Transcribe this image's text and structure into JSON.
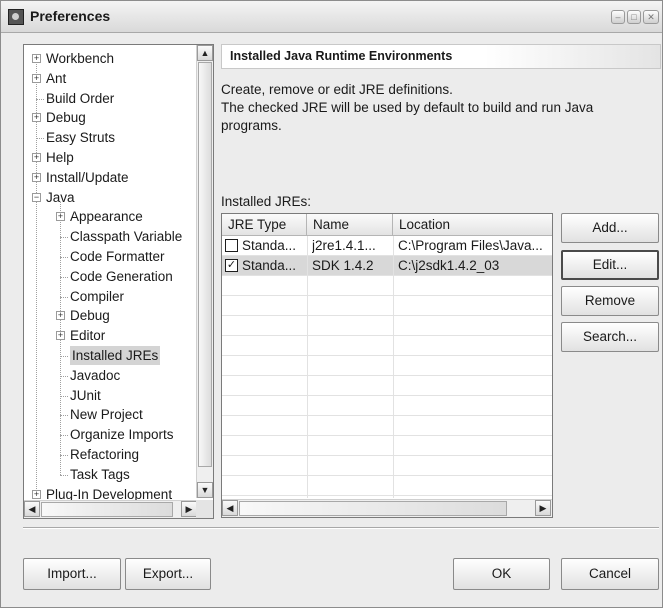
{
  "window": {
    "title": "Preferences"
  },
  "tree": {
    "items": [
      {
        "label": "Workbench",
        "expander": "+",
        "level": 0
      },
      {
        "label": "Ant",
        "expander": "+",
        "level": 0
      },
      {
        "label": "Build Order",
        "expander": "",
        "level": 0
      },
      {
        "label": "Debug",
        "expander": "+",
        "level": 0
      },
      {
        "label": "Easy Struts",
        "expander": "",
        "level": 0
      },
      {
        "label": "Help",
        "expander": "+",
        "level": 0
      },
      {
        "label": "Install/Update",
        "expander": "+",
        "level": 0
      },
      {
        "label": "Java",
        "expander": "-",
        "level": 0
      },
      {
        "label": "Appearance",
        "expander": "+",
        "level": 1
      },
      {
        "label": "Classpath Variable",
        "expander": "",
        "level": 1
      },
      {
        "label": "Code Formatter",
        "expander": "",
        "level": 1
      },
      {
        "label": "Code Generation",
        "expander": "",
        "level": 1
      },
      {
        "label": "Compiler",
        "expander": "",
        "level": 1
      },
      {
        "label": "Debug",
        "expander": "+",
        "level": 1
      },
      {
        "label": "Editor",
        "expander": "+",
        "level": 1
      },
      {
        "label": "Installed JREs",
        "expander": "",
        "level": 1,
        "selected": true
      },
      {
        "label": "Javadoc",
        "expander": "",
        "level": 1
      },
      {
        "label": "JUnit",
        "expander": "",
        "level": 1
      },
      {
        "label": "New Project",
        "expander": "",
        "level": 1
      },
      {
        "label": "Organize Imports",
        "expander": "",
        "level": 1
      },
      {
        "label": "Refactoring",
        "expander": "",
        "level": 1
      },
      {
        "label": "Task Tags",
        "expander": "",
        "level": 1
      },
      {
        "label": "Plug-In Development",
        "expander": "+",
        "level": 0
      }
    ]
  },
  "page": {
    "header": "Installed Java Runtime Environments",
    "description": [
      "Create, remove or edit JRE definitions.",
      "The checked JRE will be used by default to build and run Java",
      "programs."
    ],
    "installed_label": "Installed JREs:"
  },
  "jre_table": {
    "columns": [
      "JRE Type",
      "Name",
      "Location"
    ],
    "rows": [
      {
        "checked": false,
        "type": "Standa...",
        "name": "j2re1.4.1...",
        "location": "C:\\Program Files\\Java..."
      },
      {
        "checked": true,
        "type": "Standa...",
        "name": "SDK 1.4.2",
        "location": "C:\\j2sdk1.4.2_03"
      }
    ]
  },
  "side_buttons": {
    "add": "Add...",
    "edit": "Edit...",
    "remove": "Remove",
    "search": "Search..."
  },
  "bottom_buttons": {
    "import": "Import...",
    "export": "Export...",
    "ok": "OK",
    "cancel": "Cancel"
  },
  "icons": {
    "minimize": "minimize-icon",
    "maximize": "maximize-icon",
    "close": "close-icon",
    "scroll_up": "arrow-up-icon",
    "scroll_down": "arrow-down-icon",
    "scroll_left": "arrow-left-icon",
    "scroll_right": "arrow-right-icon",
    "checkbox": "checkbox-icon"
  }
}
